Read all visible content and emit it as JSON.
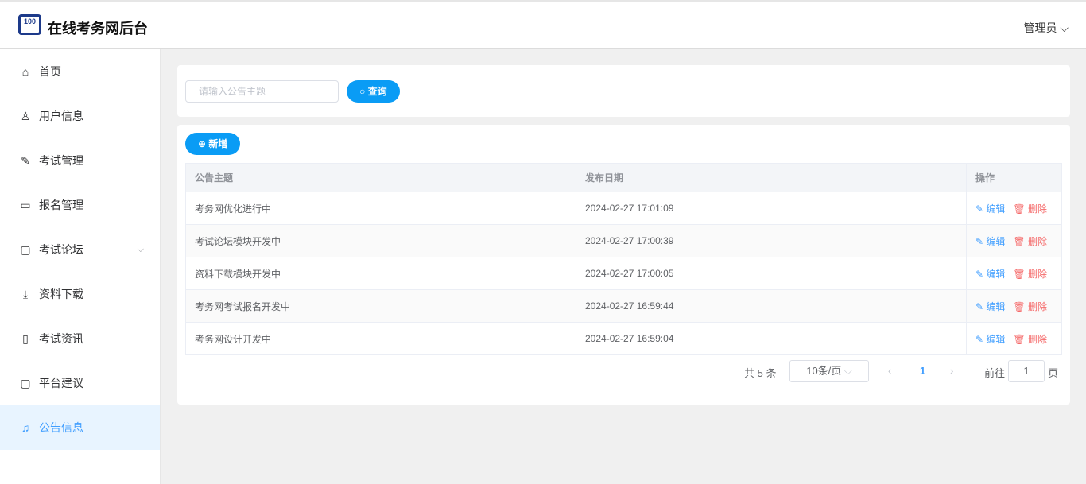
{
  "header": {
    "title": "在线考务网后台",
    "logo_text": "100",
    "user": "管理员"
  },
  "sidebar": {
    "items": [
      {
        "label": "首页",
        "icon": "home-icon",
        "glyph": "⌂"
      },
      {
        "label": "用户信息",
        "icon": "user-icon",
        "glyph": "♙"
      },
      {
        "label": "考试管理",
        "icon": "edit-icon",
        "glyph": "✎"
      },
      {
        "label": "报名管理",
        "icon": "card-icon",
        "glyph": "▭"
      },
      {
        "label": "考试论坛",
        "icon": "chat-icon",
        "glyph": "▢"
      },
      {
        "label": "资料下载",
        "icon": "download-icon",
        "glyph": "⤓"
      },
      {
        "label": "考试资讯",
        "icon": "news-icon",
        "glyph": "▯"
      },
      {
        "label": "平台建议",
        "icon": "comment-icon",
        "glyph": "▢"
      },
      {
        "label": "公告信息",
        "icon": "bell-icon",
        "glyph": "♫"
      }
    ]
  },
  "search": {
    "placeholder": "请输入公告主题",
    "button": "查询"
  },
  "add_button": "新增",
  "table": {
    "headers": [
      "公告主题",
      "发布日期",
      "操作"
    ],
    "rows": [
      {
        "title": "考务网优化进行中",
        "date": "2024-02-27 17:01:09"
      },
      {
        "title": "考试论坛模块开发中",
        "date": "2024-02-27 17:00:39"
      },
      {
        "title": "资料下载模块开发中",
        "date": "2024-02-27 17:00:05"
      },
      {
        "title": "考务网考试报名开发中",
        "date": "2024-02-27 16:59:44"
      },
      {
        "title": "考务网设计开发中",
        "date": "2024-02-27 16:59:04"
      }
    ],
    "edit": "编辑",
    "delete": "删除"
  },
  "pagination": {
    "total": "共 5 条",
    "page_size": "10条/页",
    "current": "1",
    "goto": "前往",
    "goto_value": "1",
    "page_unit": "页"
  }
}
